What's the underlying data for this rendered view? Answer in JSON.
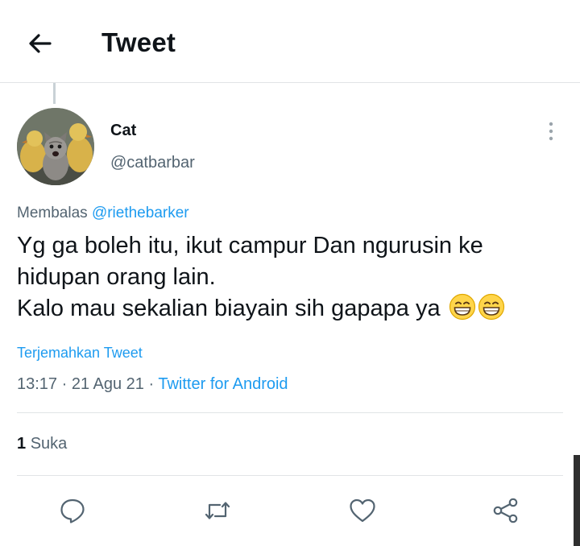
{
  "header": {
    "title": "Tweet",
    "back_icon": "arrow-left-icon"
  },
  "tweet": {
    "author": {
      "name": "Cat",
      "handle": "@catbarbar",
      "avatar": "cat-with-ducklings-avatar"
    },
    "reply_to": {
      "prefix": "Membalas",
      "mention": "@riethebarker"
    },
    "text_lines": [
      "Yg ga boleh itu, ikut campur Dan ngurusin ke",
      "hidupan orang lain.",
      "Kalo mau sekalian biayain sih gapapa ya"
    ],
    "emoji": "grinning-face-with-smiling-eyes",
    "translate_label": "Terjemahkan Tweet",
    "time": "13:17",
    "date": "21 Agu 21",
    "source": "Twitter for Android",
    "likes": {
      "count": "1",
      "label": "Suka"
    }
  },
  "actions": [
    "reply-icon",
    "retweet-icon",
    "like-icon",
    "share-icon"
  ],
  "colors": {
    "accent": "#1d9bf0",
    "text": "#0f1419",
    "secondary": "#536471",
    "divider": "#e1e4e6"
  }
}
